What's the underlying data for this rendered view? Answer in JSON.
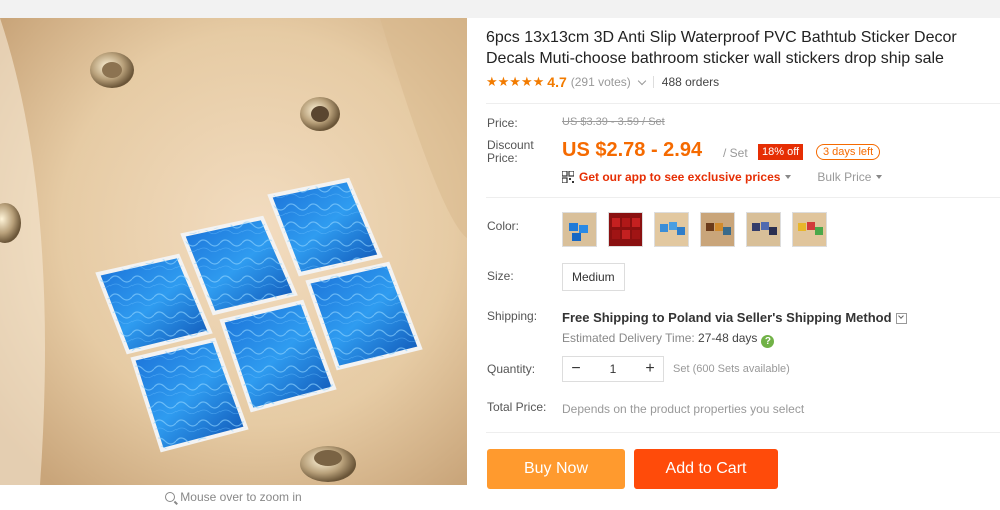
{
  "product": {
    "title": "6pcs 13x13cm 3D Anti Slip Waterproof PVC Bathtub Sticker Decor Decals Muti-choose bathroom sticker wall stickers drop ship sale",
    "stars": "★★★★★",
    "rating": "4.7",
    "votes": "(291 votes)",
    "orders": "488 orders",
    "zoom_hint": "Mouse over to zoom in"
  },
  "price": {
    "price_label": "Price:",
    "original": "US $3.39 - 3.59 / Set",
    "discount_label": "Discount Price:",
    "current": "US $2.78 - 2.94",
    "unit": "/ Set",
    "discount_badge": "18% off",
    "days_left": "3 days left",
    "app_promo": "Get our app to see exclusive prices",
    "bulk_price": "Bulk Price"
  },
  "props": {
    "color_label": "Color:",
    "size_label": "Size:",
    "size_value": "Medium",
    "shipping_label": "Shipping:",
    "shipping_main": "Free Shipping to Poland via Seller's Shipping Method",
    "delivery_label": "Estimated Delivery Time:",
    "delivery_value": "27-48 days",
    "qmark": "?",
    "quantity_label": "Quantity:",
    "quantity_value": "1",
    "minus": "−",
    "plus": "+",
    "availability": "Set (600 Sets available)",
    "total_label": "Total Price:",
    "total_note": "Depends on the product properties you select"
  },
  "actions": {
    "buy_now": "Buy Now",
    "add_to_cart": "Add to Cart"
  },
  "colors": {
    "accent_orange": "#f56a00",
    "buy_button": "#ff9a2e",
    "cart_button": "#ff4b0a",
    "discount_red": "#e62e04"
  }
}
